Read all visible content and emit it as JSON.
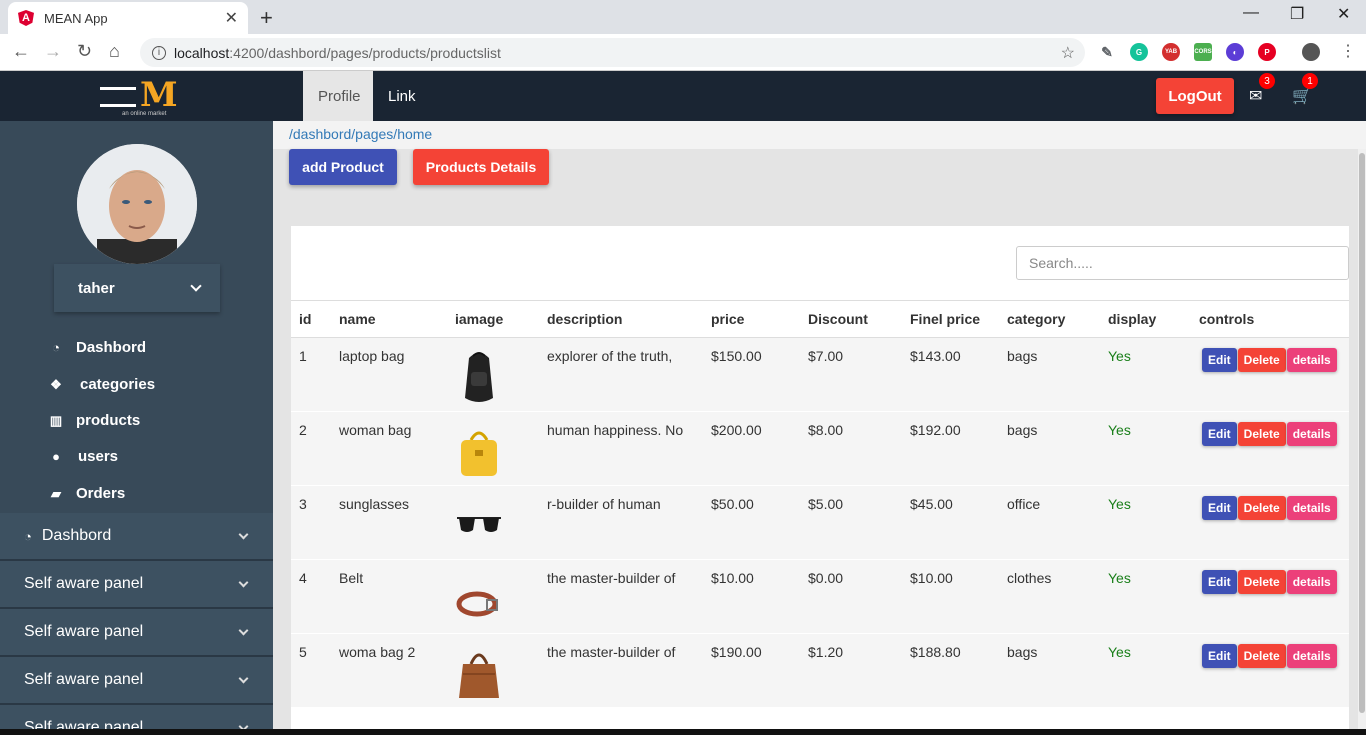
{
  "browser": {
    "tab_title": "MEAN App",
    "favicon_letter": "A",
    "url_host": "localhost",
    "url_path": ":4200/dashbord/pages/products/productslist",
    "extensions": [
      {
        "name": "eyedropper-icon",
        "label": "",
        "color": "#5f6368"
      },
      {
        "name": "grammarly-icon",
        "label": "G",
        "color": "#15c39a"
      },
      {
        "name": "yab-icon",
        "label": "YAB",
        "color": "#d32f2f"
      },
      {
        "name": "cors-icon",
        "label": "CORS",
        "color": "#4caf50"
      },
      {
        "name": "moon-icon",
        "label": "",
        "color": "#5c3dd6"
      },
      {
        "name": "pinterest-icon",
        "label": "P",
        "color": "#e60023"
      }
    ]
  },
  "header": {
    "logo_letter": "M",
    "logo_tagline": "an online market",
    "tabs": [
      {
        "label": "Profile"
      },
      {
        "label": "Link"
      }
    ],
    "logout_label": "LogOut",
    "mail_count": "3",
    "cart_count": "1"
  },
  "sidebar": {
    "username": "taher",
    "nav": [
      {
        "label": "Dashbord",
        "icon": "dashboard-icon"
      },
      {
        "label": "categories",
        "icon": "cubes-icon"
      },
      {
        "label": "products",
        "icon": "barcode-icon"
      },
      {
        "label": "users",
        "icon": "users-icon"
      },
      {
        "label": "Orders",
        "icon": "shopping-bag-icon"
      }
    ],
    "panels": [
      {
        "label": "Dashbord"
      },
      {
        "label": "Self aware panel"
      },
      {
        "label": "Self aware panel"
      },
      {
        "label": "Self aware panel"
      },
      {
        "label": "Self aware panel"
      }
    ]
  },
  "main": {
    "breadcrumb": "/dashbord/pages/home",
    "add_product_label": "add Product",
    "products_details_label": "Products Details",
    "search_placeholder": "Search.....",
    "columns": [
      "id",
      "name",
      "iamage",
      "description",
      "price",
      "Discount",
      "Finel price",
      "category",
      "display",
      "controls"
    ],
    "control_labels": {
      "edit": "Edit",
      "delete": "Delete",
      "details": "details"
    },
    "rows": [
      {
        "id": "1",
        "name": "laptop bag",
        "image": "backpack-image",
        "description": "explorer of the truth,",
        "price": "$150.00",
        "discount": "$7.00",
        "final": "$143.00",
        "category": "bags",
        "display": "Yes"
      },
      {
        "id": "2",
        "name": "woman bag",
        "image": "yellow-handbag-image",
        "description": "human happiness. No",
        "price": "$200.00",
        "discount": "$8.00",
        "final": "$192.00",
        "category": "bags",
        "display": "Yes"
      },
      {
        "id": "3",
        "name": "sunglasses",
        "image": "sunglasses-image",
        "description": "r-builder of human",
        "price": "$50.00",
        "discount": "$5.00",
        "final": "$45.00",
        "category": "office",
        "display": "Yes"
      },
      {
        "id": "4",
        "name": "Belt",
        "image": "belt-image",
        "description": "the master-builder of",
        "price": "$10.00",
        "discount": "$0.00",
        "final": "$10.00",
        "category": "clothes",
        "display": "Yes"
      },
      {
        "id": "5",
        "name": "woma bag 2",
        "image": "brown-handbag-image",
        "description": "the master-builder of",
        "price": "$190.00",
        "discount": "$1.20",
        "final": "$188.80",
        "category": "bags",
        "display": "Yes"
      }
    ]
  },
  "colors": {
    "header_bg": "#1a2533",
    "sidebar_bg": "#384a59",
    "primary_button": "#3f51b5",
    "danger_button": "#f44336",
    "pink_button": "#ec407a",
    "display_yes": "#1a7f1a"
  }
}
